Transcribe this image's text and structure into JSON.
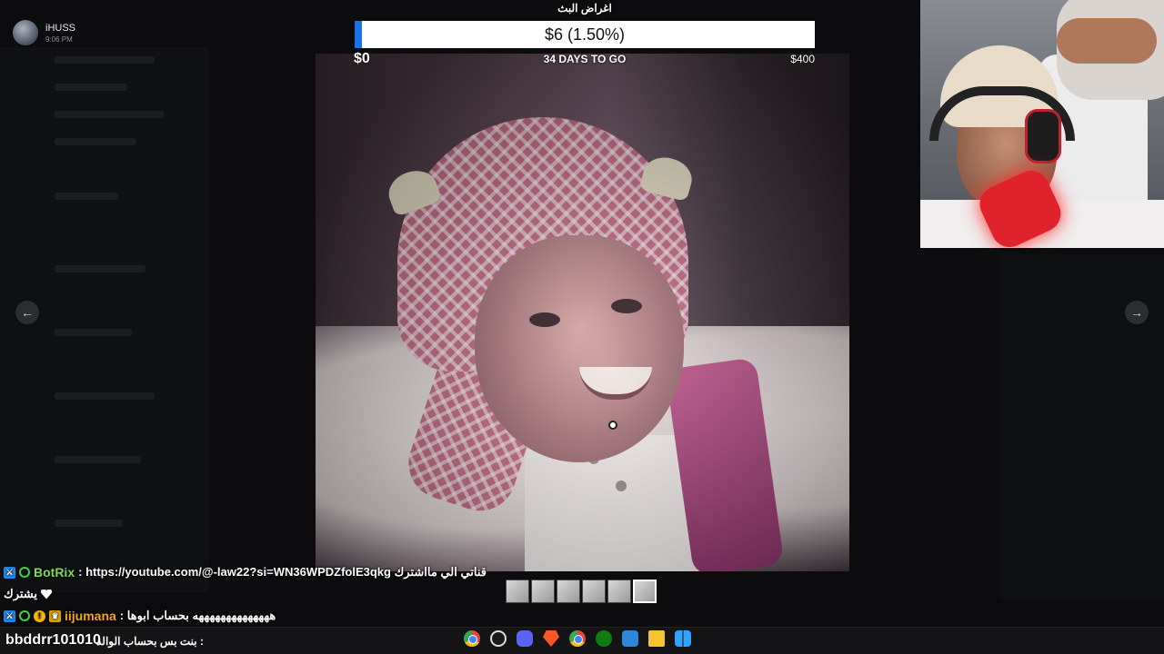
{
  "poster": {
    "name": "iHUSS",
    "time": "9:06 PM"
  },
  "goal": {
    "title": "اغراض البث",
    "amount_label": "$6 (1.50%)",
    "progress_fraction": 0.015,
    "min_label": "$0",
    "days_label": "34 DAYS TO GO",
    "max_label": "$400",
    "fill_color": "#1a73e8"
  },
  "viewer": {
    "prev_icon": "←",
    "next_icon": "→",
    "thumbnail_count": 6,
    "active_thumbnail": 5
  },
  "chat": {
    "messages": [
      {
        "badges": [
          "mod",
          "verified"
        ],
        "user": "BotRix",
        "user_color": "#7ed957",
        "text": ": https://youtube.com/@-law22?si=WN36WPDZfolE3qkg قناتي الي مااشترك"
      },
      {
        "badges": [],
        "user": "",
        "user_color": "#ffffff",
        "text": "يشترك",
        "heart": true
      },
      {
        "badges": [
          "mod",
          "verified",
          "warn",
          "crown"
        ],
        "user": "iijumana",
        "user_color": "#f5a623",
        "text": ": ههههههههههههههه بحساب ابوها"
      }
    ]
  },
  "taskbar": {
    "overlay_user": "bbddrr101010",
    "overlay_text": "بنت بس بحساب الوالد :",
    "icons": [
      "chrome-icon",
      "obs-icon",
      "discord-icon",
      "brave-icon",
      "chrome-icon",
      "xbox-icon",
      "store-icon",
      "folder-icon",
      "windows-icon"
    ]
  }
}
